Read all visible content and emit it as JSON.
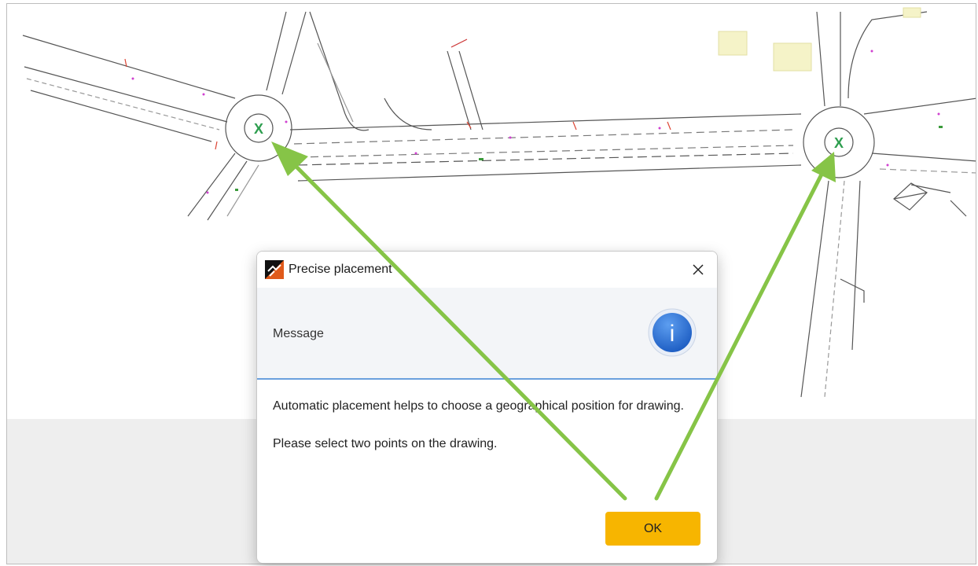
{
  "dialog": {
    "title": "Precise placement",
    "header_label": "Message",
    "body_line1": "Automatic placement helps to choose a geographical position for  drawing.",
    "body_line2": "Please select two points on the drawing.",
    "ok_label": "OK",
    "close_glyph": "✕",
    "info_glyph": "i"
  },
  "drawing": {
    "marker_left": "X",
    "marker_right": "X"
  },
  "colors": {
    "accent_ok": "#f7b500",
    "header_separator": "#6aa0dd",
    "arrow": "#86c447",
    "marker": "#2e9e4f"
  }
}
